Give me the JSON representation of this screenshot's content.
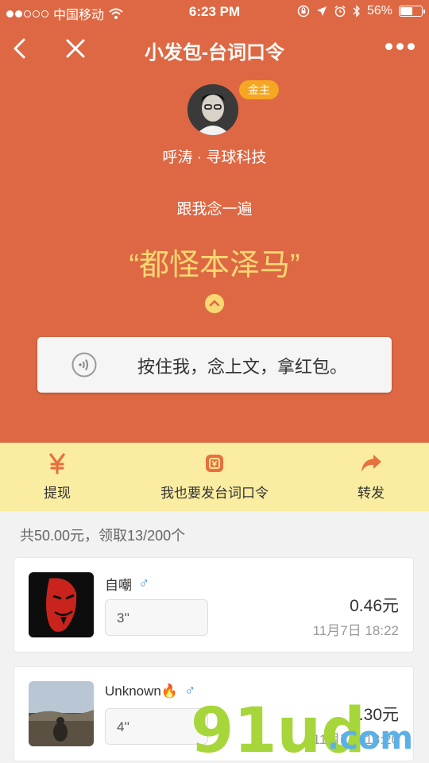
{
  "status_bar": {
    "carrier": "中国移动",
    "time": "6:23 PM",
    "battery": "56%",
    "battery_level": 0.56
  },
  "nav": {
    "title": "小发包-台词口令"
  },
  "header": {
    "badge": "金主",
    "author": "呼涛 · 寻球科技",
    "hint": "跟我念一遍",
    "phrase": "“都怪本泽马”",
    "voice_button": "按住我，念上文，拿红包。"
  },
  "actions": [
    {
      "label": "提现",
      "icon": "yen-icon"
    },
    {
      "label": "我也要发台词口令",
      "icon": "red-packet-icon"
    },
    {
      "label": "转发",
      "icon": "share-arrow-icon"
    }
  ],
  "summary": "共50.00元，领取13/200个",
  "records": [
    {
      "name": "自嘲",
      "gender": "♂",
      "voice_length": "3''",
      "amount": "0.46元",
      "time": "11月7日 18:22"
    },
    {
      "name": "Unknown🔥",
      "gender": "♂",
      "voice_length": "4''",
      "amount": "0.30元",
      "time": "11月7日 18:20"
    }
  ],
  "watermark": {
    "text": "91ud",
    "suffix": ".com"
  },
  "colors": {
    "header_bg": "#de6843",
    "actions_bg": "#faeca1",
    "accent": "#f9d872",
    "badge": "#f5a623"
  }
}
